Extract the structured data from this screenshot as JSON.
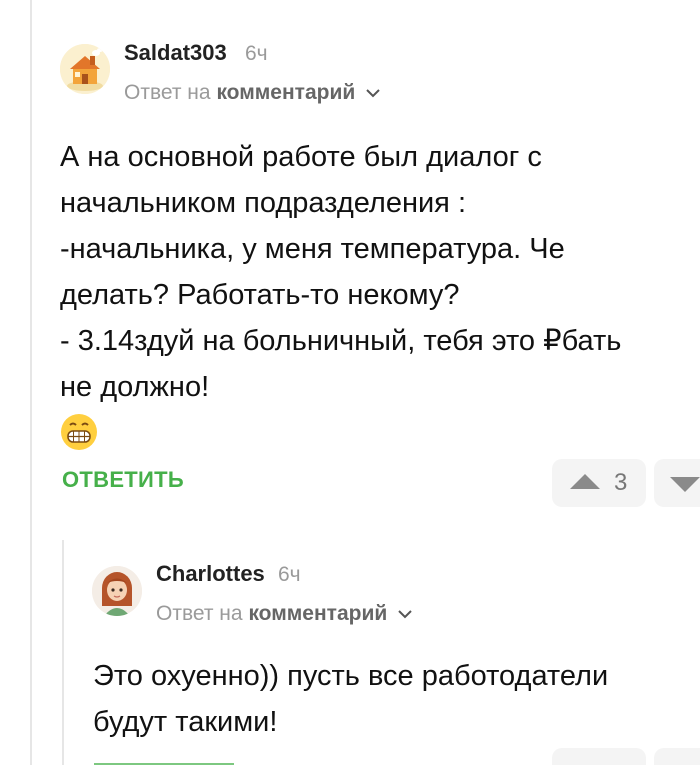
{
  "comments": [
    {
      "username": "Saldat303",
      "time": "6ч",
      "reply_prefix": "Ответ на",
      "reply_target": "комментарий",
      "body_lines": [
        "А на основной работе был диалог с",
        "начальником подразделения :",
        "-начальника, у меня температура. Че",
        "делать? Работать-то некому?",
        "- 3.14здуй на больничный, тебя это ₽бать",
        "не должно!"
      ],
      "emoji": "grinning-face-emoji",
      "reply_button": "ОТВЕТИТЬ",
      "votes": "3"
    },
    {
      "username": "Charlottes",
      "time": "6ч",
      "reply_prefix": "Ответ на",
      "reply_target": "комментарий",
      "body_lines": [
        "Это охуенно)) пусть все работодатели",
        "будут такими!"
      ]
    }
  ],
  "colors": {
    "accent_green": "#46b04a",
    "muted_text": "#9a9a9a",
    "vote_bg": "#f4f4f4"
  }
}
